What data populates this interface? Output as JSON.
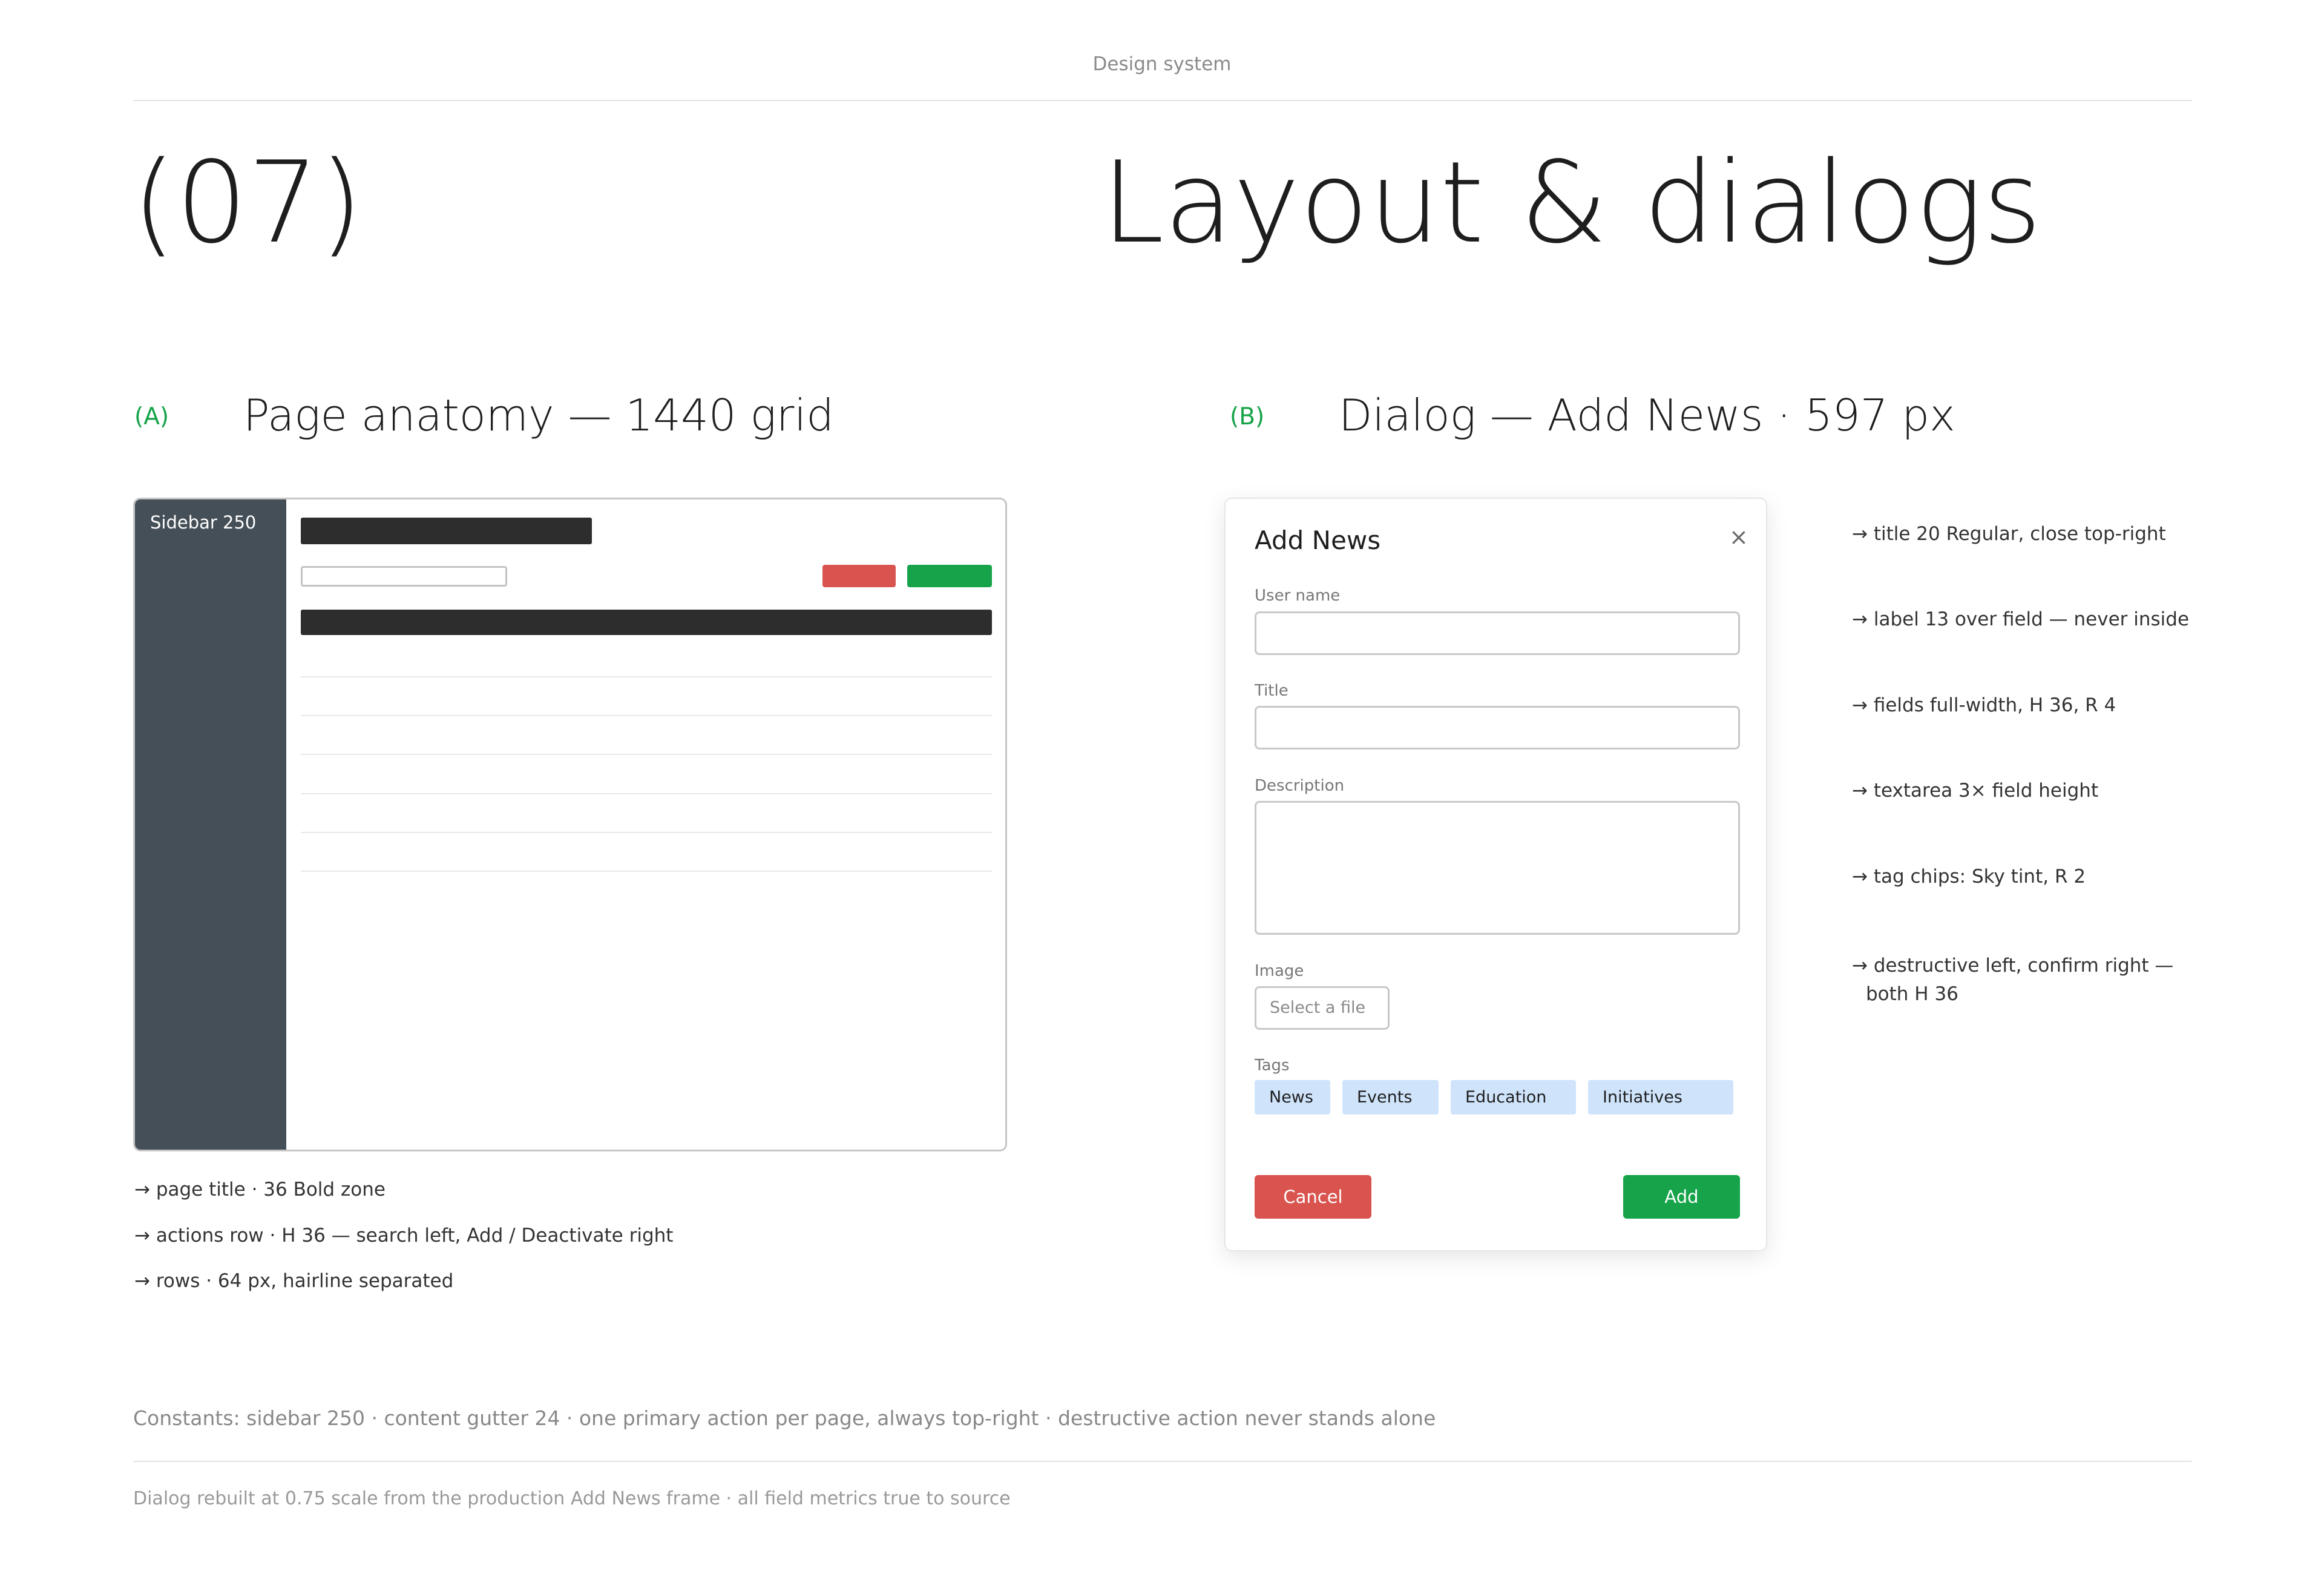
{
  "header": {
    "eyebrow": "Design system",
    "number": "(07)",
    "title": "Layout & dialogs"
  },
  "section_a": {
    "letter": "(A)",
    "title": "Page anatomy — 1440 grid",
    "sidebar_label": "Sidebar 250",
    "notes": [
      "→ page title · 36 Bold zone",
      "→ actions row · H 36 — search left, Add / Deactivate right",
      "→ rows · 64 px, hairline separated"
    ]
  },
  "section_b": {
    "letter": "(B)",
    "title": "Dialog — Add News · 597 px",
    "dialog": {
      "title": "Add News",
      "close": "×",
      "fields": {
        "user_name_label": "User name",
        "title_label": "Title",
        "description_label": "Description",
        "image_label": "Image",
        "file_placeholder": "Select a file",
        "tags_label": "Tags"
      },
      "tags": [
        "News",
        "Events",
        "Education",
        "Initiatives"
      ],
      "cancel_label": "Cancel",
      "add_label": "Add"
    },
    "notes": [
      "→ title 20 Regular, close top-right",
      "→ label 13 over field — never inside",
      "→ fields full-width, H 36, R 4",
      "→ textarea 3× field height",
      "→ tag chips: Sky tint, R 2",
      "→ destructive left, confirm right —",
      "both H 36"
    ]
  },
  "colors": {
    "accent_green": "#16a34a",
    "destructive_red": "#d9534f",
    "sidebar": "#454f57",
    "chip_sky": "#cfe4fb"
  },
  "footer": {
    "constants": "Constants: sidebar 250 · content gutter 24 · one primary action per page, always top-right · destructive action never stands alone",
    "source_note": "Dialog rebuilt at 0.75 scale from the production Add News frame · all field metrics true to source"
  }
}
